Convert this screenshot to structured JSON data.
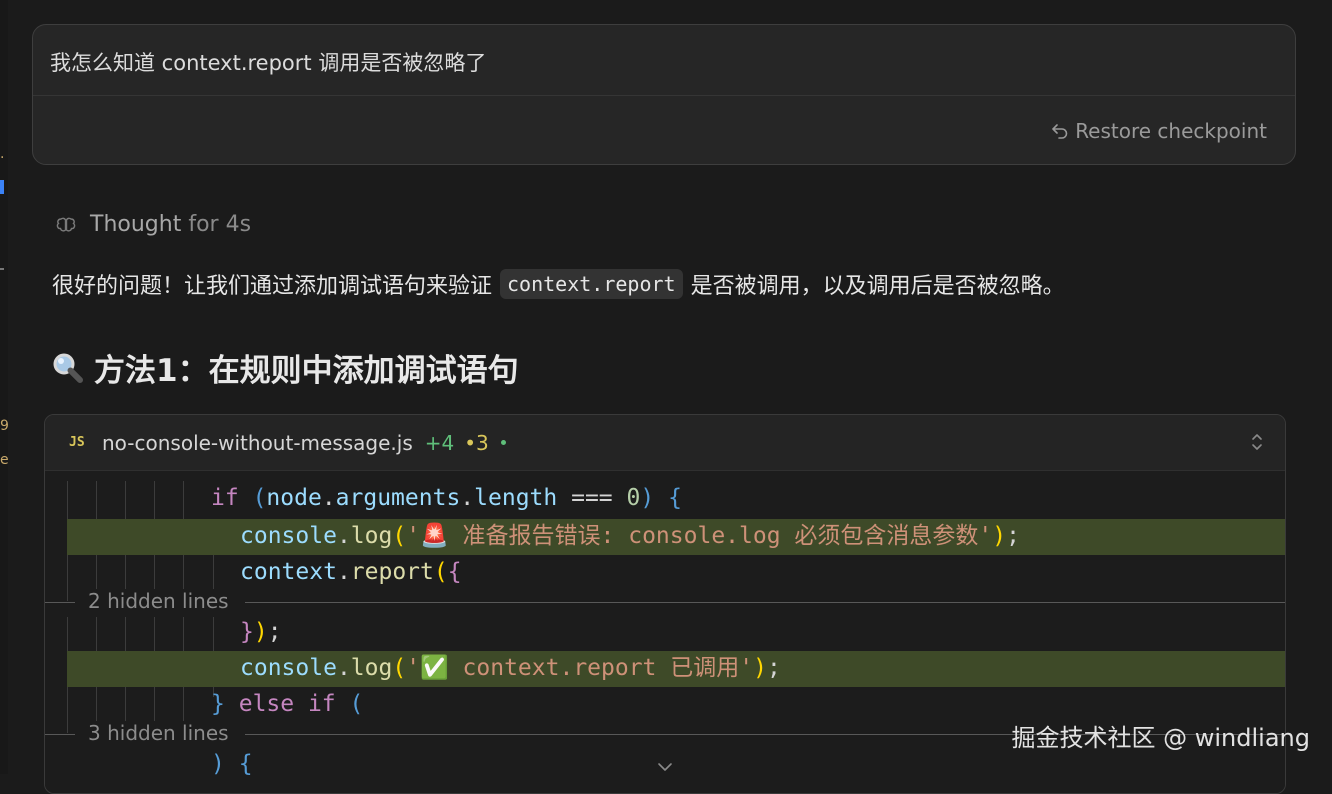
{
  "user_message": {
    "text": "我怎么知道 context.report 调用是否被忽略了",
    "restore_label": "Restore checkpoint"
  },
  "thought": {
    "label": "Thought",
    "duration": "for 4s"
  },
  "answer": {
    "before": "很好的问题！让我们通过添加调试语句来验证",
    "code": "context.report",
    "after": "是否被调用，以及调用后是否被忽略。"
  },
  "heading": {
    "icon": "magnifier-icon",
    "text": "方法1：在规则中添加调试语句"
  },
  "code_block": {
    "lang_badge": "JS",
    "filename": "no-console-without-message.js",
    "added": "+4",
    "modified": "•3",
    "hidden_1": "2 hidden lines",
    "hidden_2": "3 hidden lines",
    "colors": {
      "added_bg": "#3e4a28",
      "add_count": "#5fbf7a",
      "mod_count": "#d9c65a"
    }
  },
  "watermark": "掘金技术社区 @ windliang"
}
